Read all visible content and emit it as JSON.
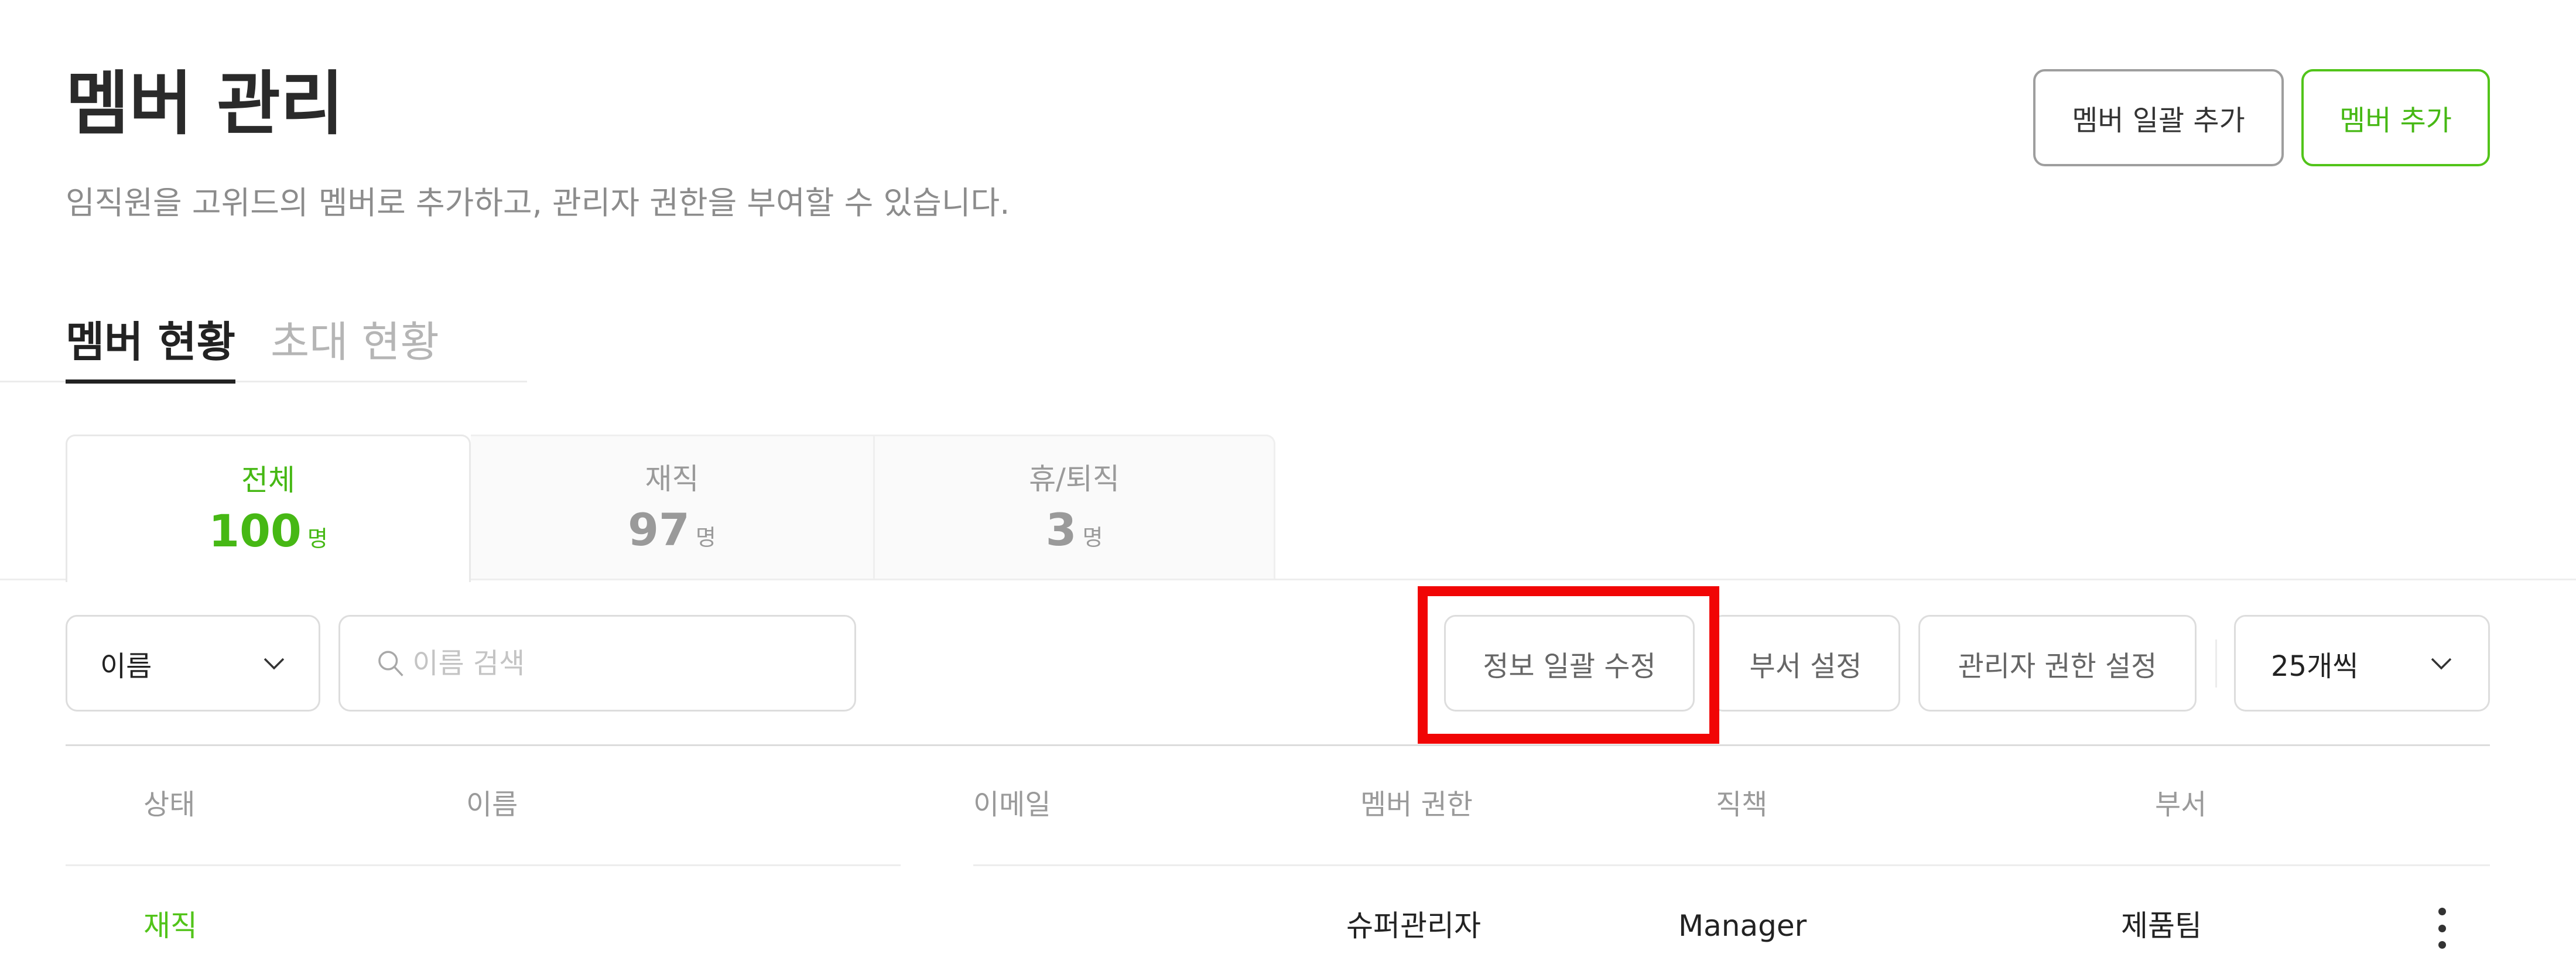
{
  "header": {
    "title": "멤버 관리",
    "subtitle": "임직원을 고위드의 멤버로 추가하고, 관리자 권한을 부여할 수 있습니다.",
    "bulk_add_label": "멤버 일괄 추가",
    "add_label": "멤버 추가"
  },
  "tabs": [
    {
      "label": "멤버 현황",
      "active": true
    },
    {
      "label": "초대 현황",
      "active": false
    }
  ],
  "stats": [
    {
      "label": "전체",
      "count": "100",
      "unit": "명",
      "selected": true
    },
    {
      "label": "재직",
      "count": "97",
      "unit": "명",
      "selected": false
    },
    {
      "label": "휴/퇴직",
      "count": "3",
      "unit": "명",
      "selected": false
    }
  ],
  "toolbar": {
    "filter_select_value": "이름",
    "search_placeholder": "이름 검색",
    "bulk_edit_label": "정보 일괄 수정",
    "dept_setting_label": "부서 설정",
    "admin_setting_label": "관리자 권한 설정",
    "page_size_value": "25개씩"
  },
  "table": {
    "columns": [
      "상태",
      "이름",
      "이메일",
      "멤버 권한",
      "직책",
      "부서"
    ],
    "rows": [
      {
        "status": "재직",
        "name": "",
        "email": "",
        "role": "슈퍼관리자",
        "position": "Manager",
        "department": "제품팀"
      }
    ]
  },
  "colors": {
    "accent": "#52c41a",
    "highlight": "#f10505",
    "muted_text": "#9a9a9a"
  }
}
